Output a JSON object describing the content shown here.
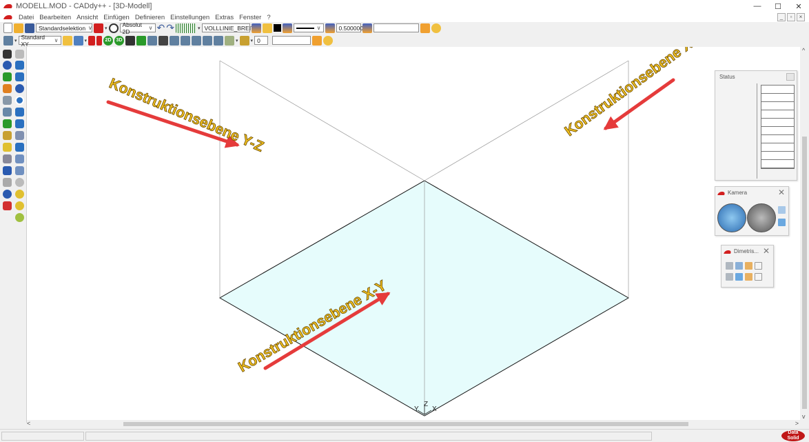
{
  "window": {
    "title": "MODELL.MOD  -  CADdy++  - [3D-Modell]",
    "minimize": "—",
    "maximize": "☐",
    "close": "✕"
  },
  "menu": [
    "Datei",
    "Bearbeiten",
    "Ansicht",
    "Einfügen",
    "Definieren",
    "Einstellungen",
    "Extras",
    "Fenster",
    "?"
  ],
  "toolbar1": {
    "selection_mode": "Standardselektion",
    "coordinate_mode": "Absolut 2D",
    "line_type": "VOLLLINIE_BREIT",
    "line_width": "0.500000",
    "extra_value": ""
  },
  "toolbar2": {
    "view": "Standard XY",
    "view2d": "2D",
    "view3d": "3D",
    "layer_value": "0",
    "text_value": ""
  },
  "labels": {
    "yz": "Konstruktionsebene Y-Z",
    "xz": "Konstruktionsebene X-Z",
    "xy": "Konstruktionsebene X-Y"
  },
  "axes": {
    "y": "Y",
    "z": "Z",
    "x": "X"
  },
  "panels": {
    "status_title": "Status",
    "camera_title": "Kamera",
    "dimetric_title": "Dimetris..."
  },
  "brand": {
    "logo": "Data Solid"
  },
  "colors": {
    "plane_fill": "#e6fcfc",
    "label_fill": "#f0c020",
    "arrow": "#e53b3b",
    "accent_red": "#d21f1f"
  }
}
